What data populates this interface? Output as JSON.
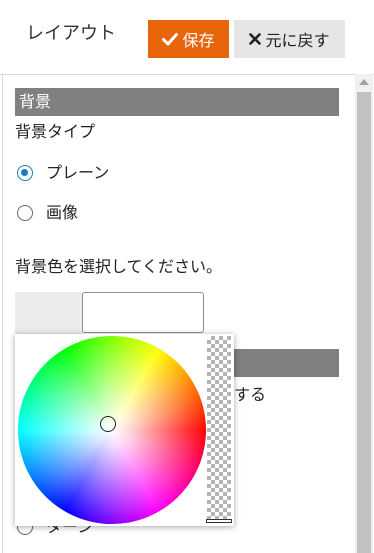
{
  "header": {
    "title": "レイアウト",
    "save_label": "保存",
    "revert_label": "元に戻す"
  },
  "background_section": {
    "heading": "背景",
    "type_label": "背景タイプ",
    "options": [
      {
        "label": "プレーン",
        "selected": true
      },
      {
        "label": "画像",
        "selected": false
      }
    ],
    "color_prompt": "背景色を選択してください。"
  },
  "partially_hidden": {
    "trailing_text": "する",
    "radio_label": "ターン"
  },
  "colors": {
    "accent": "#e8650c",
    "section_bar": "#808080",
    "radio_selected": "#1a7ac4",
    "secondary_button": "#e6e6e6"
  },
  "icons": {
    "save": "check-icon",
    "revert": "close-icon"
  }
}
